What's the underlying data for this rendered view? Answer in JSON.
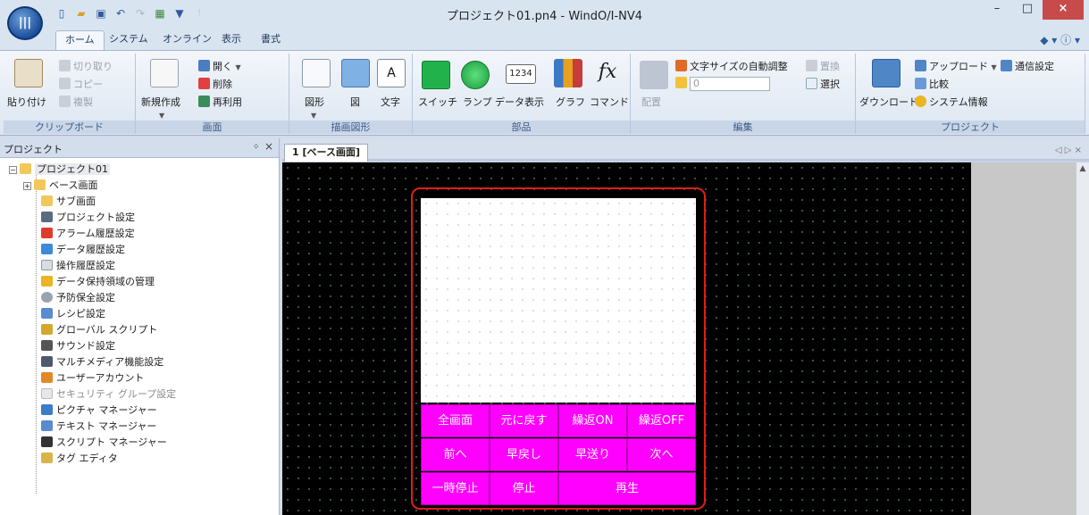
{
  "titlebar": {
    "title": "プロジェクト01.pn4 - WindO/I-NV4",
    "app_icon_label": "|||",
    "minimize": "–",
    "maximize": "□",
    "close": "×"
  },
  "ribbon_tabs": [
    "ホーム",
    "システム",
    "オンライン",
    "表示",
    "書式"
  ],
  "clipboard": {
    "paste": "貼り付け",
    "cut": "切り取り",
    "copy": "コピー",
    "duplicate": "複製",
    "label": "クリップボード"
  },
  "screen_group": {
    "new": "新規作成",
    "open": "開く",
    "delete": "削除",
    "reuse": "再利用",
    "label": "画面"
  },
  "drawing_group": {
    "shape": "図形",
    "figure": "図",
    "text": "文字",
    "text_icon": "A",
    "label": "描画図形"
  },
  "parts_group": {
    "switch": "スイッチ",
    "lamp": "ランプ",
    "data_display": "データ表示",
    "data_icon": "1234",
    "graph": "グラフ",
    "command": "コマンド",
    "command_icon": "fx",
    "label": "部品"
  },
  "edit_group": {
    "arrange": "配置",
    "auto_font": "文字サイズの自動調整",
    "spin_value": "0",
    "replace": "置換",
    "select": "選択",
    "label": "編集"
  },
  "project_group": {
    "download": "ダウンロード",
    "upload": "アップロード",
    "compare": "比較",
    "comm_settings": "通信設定",
    "system_info": "システム情報",
    "label": "プロジェクト"
  },
  "project_pane": {
    "title": "プロジェクト",
    "pin": "ᛜ",
    "close": "×",
    "tree": [
      {
        "label": "プロジェクト01"
      },
      {
        "label": "ベース画面"
      },
      {
        "label": "サブ画面"
      },
      {
        "label": "プロジェクト設定"
      },
      {
        "label": "アラーム履歴設定"
      },
      {
        "label": "データ履歴設定"
      },
      {
        "label": "操作履歴設定"
      },
      {
        "label": "データ保持領域の管理"
      },
      {
        "label": "予防保全設定"
      },
      {
        "label": "レシピ設定"
      },
      {
        "label": "グローバル スクリプト"
      },
      {
        "label": "サウンド設定"
      },
      {
        "label": "マルチメディア機能設定"
      },
      {
        "label": "ユーザーアカウント"
      },
      {
        "label": "セキュリティ グループ設定"
      },
      {
        "label": "ピクチャ マネージャー"
      },
      {
        "label": "テキスト マネージャー"
      },
      {
        "label": "スクリプト マネージャー"
      },
      {
        "label": "タグ エディタ"
      }
    ]
  },
  "document": {
    "tab_label": "1 [ベース画面]",
    "nav": "◁ ▷ ×"
  },
  "media_buttons": [
    "全画面",
    "元に戻す",
    "繰返ON",
    "繰返OFF",
    "前へ",
    "早戻し",
    "早送り",
    "次へ",
    "一時停止",
    "停止",
    "再生"
  ],
  "colors": {
    "accent_magenta": "#ff00ff",
    "selection_red": "#e21b1b"
  }
}
